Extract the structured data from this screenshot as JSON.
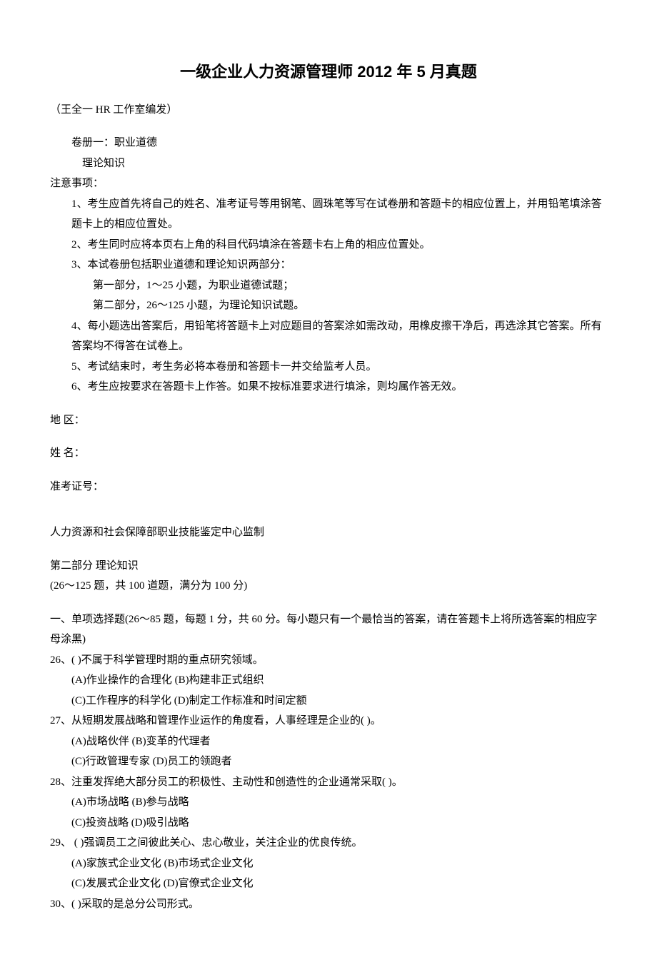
{
  "title": "一级企业人力资源管理师 2012 年 5 月真题",
  "author": "（王全一 HR 工作室编发）",
  "header": {
    "volume_line": "卷册一：职业道德",
    "volume_sub": "理论知识",
    "notice_label": "注意事项：",
    "items": {
      "n1": "1、考生应首先将自己的姓名、准考证号等用钢笔、圆珠笔等写在试卷册和答题卡的相应位置上，并用铅笔填涂答题卡上的相应位置处。",
      "n2": "2、考生同时应将本页右上角的科目代码填涂在答题卡右上角的相应位置处。",
      "n3": "3、本试卷册包括职业道德和理论知识两部分：",
      "n3a": "第一部分，1～25 小题，为职业道德试题；",
      "n3b": "第二部分，26～125 小题，为理论知识试题。",
      "n4": "4、每小题选出答案后，用铅笔将答题卡上对应题目的答案涂如需改动，用橡皮擦干净后，再选涂其它答案。所有答案均不得答在试卷上。",
      "n5": "5、考试结束时，考生务必将本卷册和答题卡一并交给监考人员。",
      "n6": "6、考生应按要求在答题卡上作答。如果不按标准要求进行填涂，则均属作答无效。"
    }
  },
  "fields": {
    "region": "地    区：",
    "name": "姓    名：",
    "admission": "准考证号："
  },
  "footer_org": "人力资源和社会保障部职业技能鉴定中心监制",
  "part2_header": "第二部分   理论知识",
  "part2_sub": "(26～125 题，共 100 道题，满分为 100 分)",
  "section1_header": "一、单项选择题(26～85 题，每题 1 分，共 60 分。每小题只有一个最恰当的答案，请在答题卡上将所选答案的相应字母涂黑)",
  "questions": {
    "q26": {
      "stem": "26、(    )不属于科学管理时期的重点研究领域。",
      "opt1": "(A)作业操作的合理化    (B)构建非正式组织",
      "opt2": "(C)工作程序的科学化    (D)制定工作标准和时间定额"
    },
    "q27": {
      "stem": "27、从短期发展战略和管理作业运作的角度看，人事经理是企业的(    )。",
      "opt1": "(A)战略伙伴        (B)变革的代理者",
      "opt2": "(C)行政管理专家    (D)员工的领跑者"
    },
    "q28": {
      "stem": "28、注重发挥绝大部分员工的积极性、主动性和创造性的企业通常采取(    )。",
      "opt1": "(A)市场战略    (B)参与战略",
      "opt2": "(C)投资战略    (D)吸引战略"
    },
    "q29": {
      "stem": "29、  (    )强调员工之间彼此关心、忠心敬业，关注企业的优良传统。",
      "opt1": "(A)家族式企业文化    (B)市场式企业文化",
      "opt2": "(C)发展式企业文化    (D)官僚式企业文化"
    },
    "q30": {
      "stem": "30、(    )采取的是总分公司形式。"
    }
  }
}
